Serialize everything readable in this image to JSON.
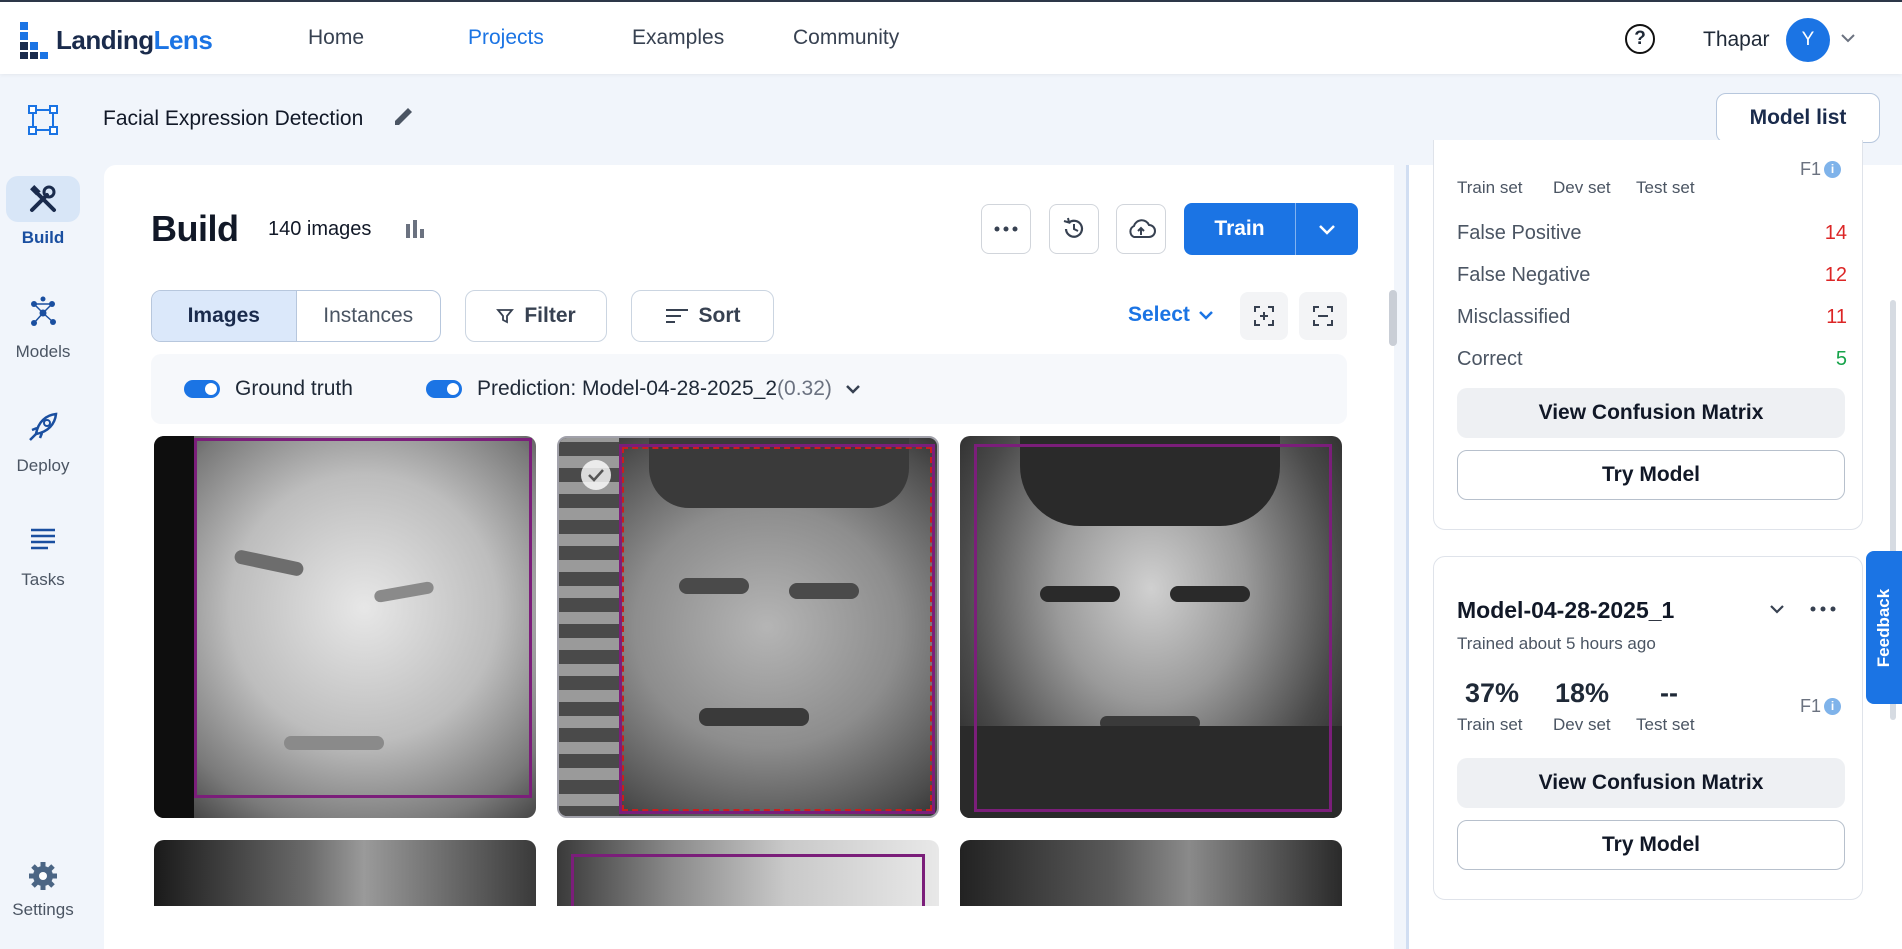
{
  "brand": {
    "name_prefix": "Landing",
    "name_suffix": "Lens"
  },
  "nav": {
    "items": [
      "Home",
      "Projects",
      "Examples",
      "Community"
    ],
    "active": "Projects"
  },
  "user": {
    "name": "Thapar",
    "initial": "Y"
  },
  "project": {
    "title": "Facial Expression Detection",
    "model_list_label": "Model list"
  },
  "sidebar": {
    "items": [
      {
        "label": "Build",
        "icon": "tools-icon",
        "active": true
      },
      {
        "label": "Models",
        "icon": "network-icon",
        "active": false
      },
      {
        "label": "Deploy",
        "icon": "rocket-icon",
        "active": false
      },
      {
        "label": "Tasks",
        "icon": "list-icon",
        "active": false
      },
      {
        "label": "Settings",
        "icon": "gear-icon",
        "active": false
      }
    ]
  },
  "build": {
    "title": "Build",
    "image_count": "140 images",
    "train_label": "Train",
    "tabs": [
      "Images",
      "Instances"
    ],
    "filter_label": "Filter",
    "sort_label": "Sort",
    "select_label": "Select",
    "ground_truth_label": "Ground truth",
    "prediction_label": "Prediction: Model-04-28-2025_2",
    "prediction_threshold": "(0.32)"
  },
  "model_cards": [
    {
      "partial_metrics": {
        "train_label": "Train set",
        "dev_label": "Dev set",
        "test_label": "Test set",
        "f1_label": "F1"
      },
      "stats": [
        {
          "label": "False Positive",
          "value": "14",
          "color": "#dc2626"
        },
        {
          "label": "False Negative",
          "value": "12",
          "color": "#dc2626"
        },
        {
          "label": "Misclassified",
          "value": "11",
          "color": "#dc2626"
        },
        {
          "label": "Correct",
          "value": "5",
          "color": "#16a34a"
        }
      ],
      "confusion_label": "View Confusion Matrix",
      "try_label": "Try Model"
    },
    {
      "name": "Model-04-28-2025_1",
      "trained": "Trained about 5 hours ago",
      "train": "37%",
      "train_label": "Train set",
      "dev": "18%",
      "dev_label": "Dev set",
      "test": "--",
      "test_label": "Test set",
      "f1_label": "F1",
      "confusion_label": "View Confusion Matrix",
      "try_label": "Try Model"
    }
  ],
  "feedback_label": "Feedback",
  "colors": {
    "accent": "#1b74e4",
    "box": "#7b1e7a",
    "prediction_box": "#b91c1c"
  }
}
